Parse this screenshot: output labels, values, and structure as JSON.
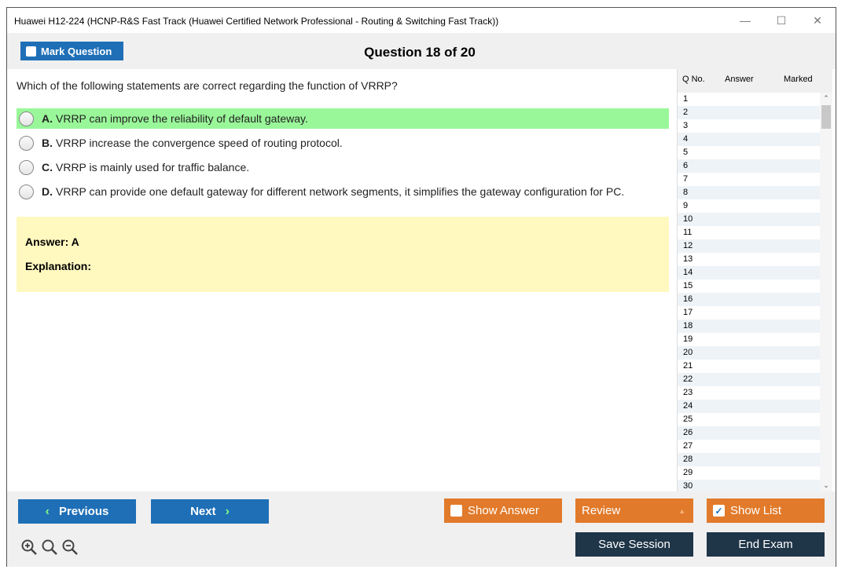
{
  "window": {
    "title": "Huawei H12-224 (HCNP-R&S Fast Track (Huawei Certified Network Professional - Routing & Switching Fast Track))",
    "controls": {
      "minimize": "—",
      "maximize": "☐",
      "close": "✕"
    }
  },
  "header": {
    "mark_label": "Mark Question",
    "question_counter": "Question 18 of 20"
  },
  "question": {
    "text": "Which of the following statements are correct regarding the function of VRRP?",
    "options": [
      {
        "letter": "A.",
        "text": "VRRP can improve the reliability of default gateway.",
        "correct": true
      },
      {
        "letter": "B.",
        "text": "VRRP increase the convergence speed of routing protocol.",
        "correct": false
      },
      {
        "letter": "C.",
        "text": "VRRP is mainly used for traffic balance.",
        "correct": false
      },
      {
        "letter": "D.",
        "text": "VRRP can provide one default gateway for different network segments, it simplifies the gateway configuration for PC.",
        "correct": false
      }
    ],
    "answer_label": "Answer: A",
    "explanation_label": "Explanation:"
  },
  "question_list": {
    "headers": {
      "qno": "Q No.",
      "answer": "Answer",
      "marked": "Marked"
    },
    "rows": [
      "1",
      "2",
      "3",
      "4",
      "5",
      "6",
      "7",
      "8",
      "9",
      "10",
      "11",
      "12",
      "13",
      "14",
      "15",
      "16",
      "17",
      "18",
      "19",
      "20",
      "21",
      "22",
      "23",
      "24",
      "25",
      "26",
      "27",
      "28",
      "29",
      "30"
    ]
  },
  "footer": {
    "previous": "Previous",
    "next": "Next",
    "show_answer": "Show Answer",
    "review": "Review",
    "show_list": "Show List",
    "save_session": "Save Session",
    "end_exam": "End Exam"
  },
  "colors": {
    "primary_blue": "#1f6fb7",
    "orange": "#e17a2a",
    "dark": "#1f3548",
    "correct_green": "#99f799",
    "answer_yellow": "#fff8bf"
  }
}
